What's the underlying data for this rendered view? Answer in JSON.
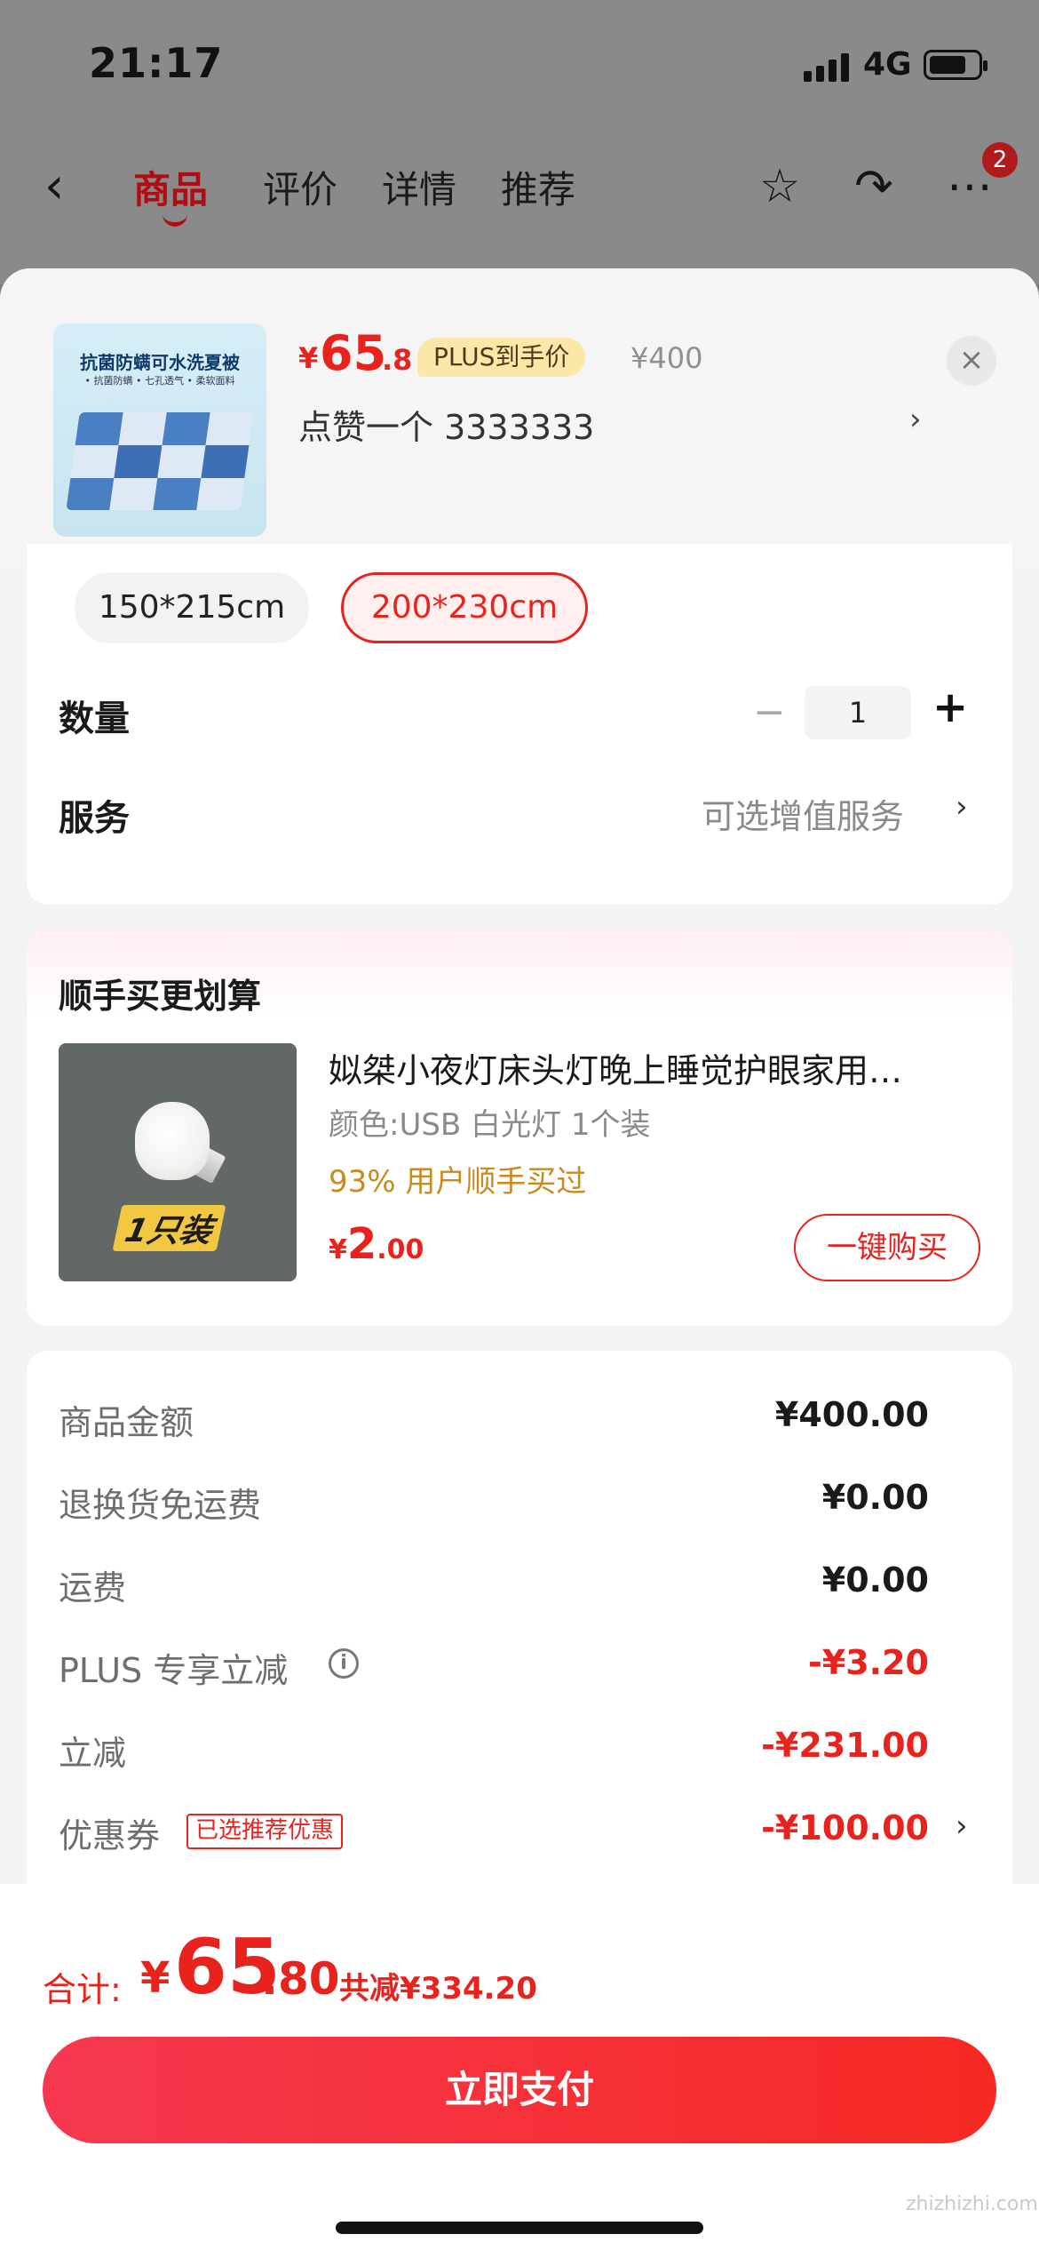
{
  "status": {
    "time": "21:17",
    "network": "4G"
  },
  "nav": {
    "back_label": "‹",
    "tabs": [
      "商品",
      "评价",
      "详情",
      "推荐"
    ],
    "active_tab": 0,
    "badge": "2"
  },
  "product": {
    "image_text": "抗菌防螨可水洗夏被",
    "image_subtext": "• 抗菌防螨 • 七孔透气 • 柔软面料",
    "price_symbol": "¥",
    "price_int": "65",
    "price_dec": ".8",
    "plus_tag": "PLUS到手价",
    "original_price": "¥400",
    "selection": "点赞一个  3333333",
    "close_label": "×",
    "chevron": "›"
  },
  "options": {
    "sizes": [
      {
        "label": "150*215cm",
        "selected": false
      },
      {
        "label": "200*230cm",
        "selected": true
      }
    ],
    "quantity_label": "数量",
    "quantity": "1",
    "minus": "−",
    "plus": "+",
    "service_label": "服务",
    "service_value": "可选增值服务",
    "chevron": "›"
  },
  "upsell": {
    "title": "顺手买更划算",
    "image_label": "1只装",
    "name": "姒桀小夜灯床头灯晚上睡觉护眼家用…",
    "spec": "颜色:USB 白光灯 1个装",
    "percent_text": "93% 用户顺手买过",
    "price_symbol": "¥",
    "price_int": "2",
    "price_dec": ".00",
    "buy_label": "一键购买"
  },
  "fees": [
    {
      "label": "商品金额",
      "value": "¥400.00",
      "negative": false
    },
    {
      "label": "退换货免运费",
      "value": "¥0.00",
      "negative": false
    },
    {
      "label": "运费",
      "value": "¥0.00",
      "negative": false
    },
    {
      "label": "PLUS 专享立减",
      "value": "-¥3.20",
      "negative": true,
      "info_icon": "i"
    },
    {
      "label": "立减",
      "value": "-¥231.00",
      "negative": true
    },
    {
      "label": "优惠券",
      "value": "-¥100.00",
      "negative": true,
      "tag": "已选推荐优惠",
      "chevron": "›"
    }
  ],
  "footer": {
    "total_label": "合计:",
    "total_symbol": "¥",
    "total_int": "65",
    "total_dec": ".80",
    "saved": "共减¥334.20",
    "pay_label": "立即支付"
  },
  "watermark": "zhizhizhi.com",
  "colors": {
    "accent": "#e8231d",
    "plus_tag_bg": "#fbe7a8",
    "upsell_percent": "#c98a1e"
  },
  "icons": [
    "back-icon",
    "star-icon",
    "share-icon",
    "more-icon",
    "close-icon",
    "chevron-right-icon",
    "info-icon"
  ]
}
